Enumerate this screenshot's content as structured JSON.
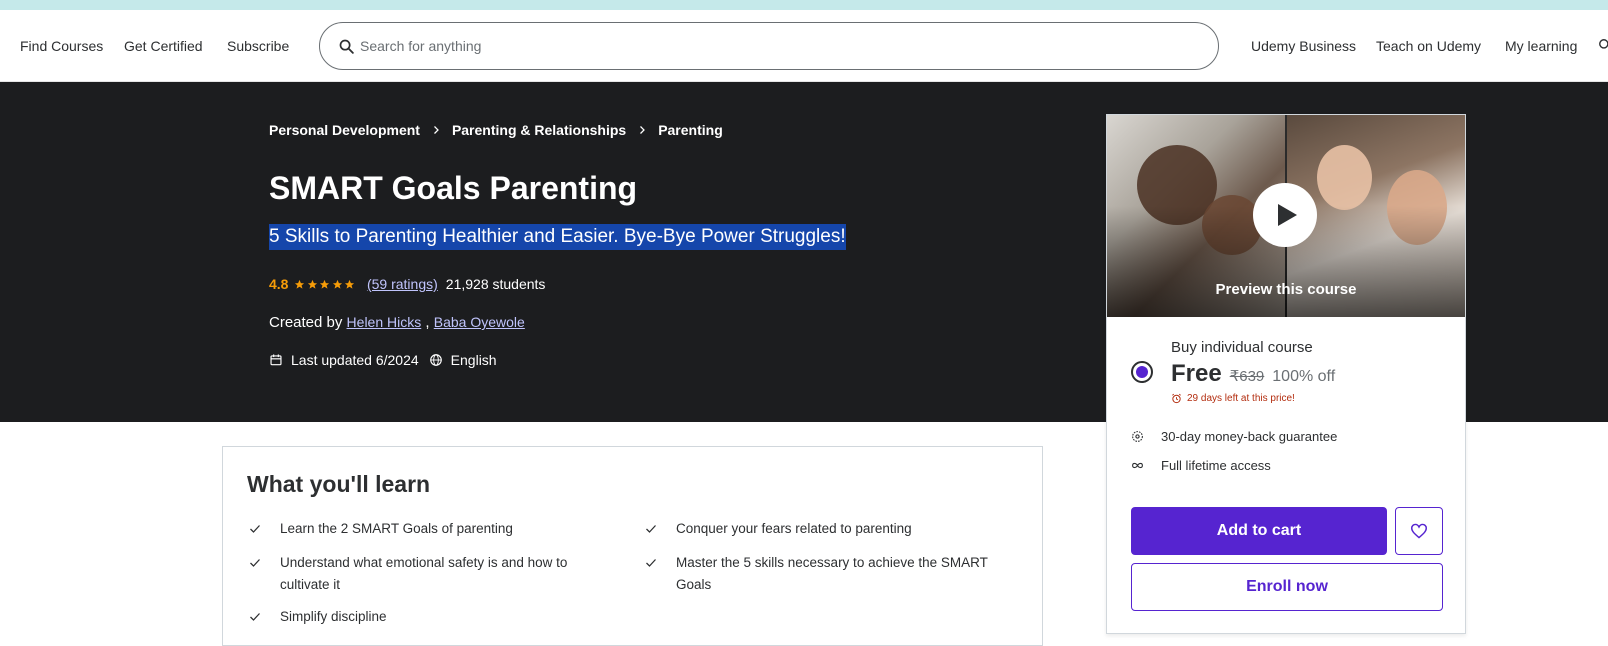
{
  "nav": {
    "links": [
      "Find Courses",
      "Get Certified",
      "Subscribe"
    ],
    "search_placeholder": "Search for anything",
    "right_links": [
      "Udemy Business",
      "Teach on Udemy",
      "My learning"
    ]
  },
  "course": {
    "breadcrumbs": [
      "Personal Development",
      "Parenting & Relationships",
      "Parenting"
    ],
    "title": "SMART Goals Parenting",
    "subtitle": "5 Skills to Parenting Healthier and Easier. Bye-Bye Power Struggles!",
    "rating": "4.8",
    "ratings_text": "(59 ratings)",
    "students_text": "21,928 students",
    "created_by_label": "Created by",
    "instructors": [
      "Helen Hicks",
      "Baba Oyewole"
    ],
    "instructor_separator": ",",
    "last_updated": "Last updated 6/2024",
    "language": "English"
  },
  "sidebar": {
    "preview_label": "Preview this course",
    "buy_label": "Buy individual course",
    "price": "Free",
    "original_price": "₹639",
    "discount": "100% off",
    "countdown": "29 days left at this price!",
    "features": [
      "30-day money-back guarantee",
      "Full lifetime access"
    ],
    "add_to_cart": "Add to cart",
    "enroll_now": "Enroll now"
  },
  "learn": {
    "title": "What you'll learn",
    "items": [
      "Learn the 2 SMART Goals of parenting",
      "Conquer your fears related to parenting",
      "Understand what emotional safety is and how to cultivate it",
      "Master the 5 skills necessary to achieve the SMART Goals",
      "Simplify discipline"
    ]
  },
  "colors": {
    "hero_bg": "#1c1d1f",
    "brand_purple": "#5624d0",
    "rating_orange": "#f69c08",
    "link_lavender": "#c0c4fc",
    "selection_blue": "#1546ab",
    "countdown_red": "#b32d0f"
  },
  "icons": [
    "search-icon",
    "cart-icon",
    "chevron-right-icon",
    "star-icon",
    "calendar-icon",
    "globe-icon",
    "play-icon",
    "alarm-clock-icon",
    "money-back-icon",
    "infinity-icon",
    "heart-icon",
    "check-icon"
  ]
}
